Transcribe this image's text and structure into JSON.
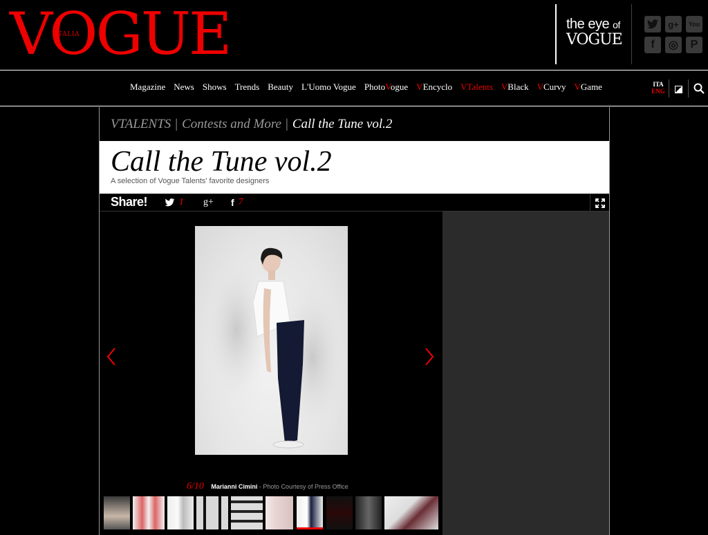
{
  "header": {
    "logo": "VOGUE",
    "logo_sub": "ITALIA",
    "eye_the": "the eye",
    "eye_of": "of",
    "eye_vogue": "VOGUE",
    "social": [
      "twitter-icon",
      "google-plus-icon",
      "youtube-icon",
      "facebook-icon",
      "instagram-icon",
      "pinterest-icon"
    ],
    "social_glyphs": [
      "t",
      "g+",
      "You",
      "f",
      "◎",
      "P"
    ]
  },
  "nav": {
    "items": [
      {
        "label": "Magazine"
      },
      {
        "label": "News"
      },
      {
        "label": "Shows"
      },
      {
        "label": "Trends"
      },
      {
        "label": "Beauty"
      },
      {
        "label": "L'Uomo Vogue"
      },
      {
        "pre": "Photo",
        "v": "V",
        "post": "ogue"
      },
      {
        "v": "V",
        "post": "Encyclo"
      },
      {
        "v": "V",
        "post": "Talents"
      },
      {
        "v": "V",
        "post": "Black"
      },
      {
        "v": "V",
        "post": "Curvy"
      },
      {
        "v": "V",
        "post": "Game"
      }
    ],
    "lang_ita": "ITA",
    "lang_eng": "ENG"
  },
  "breadcrumb": {
    "items": [
      "VTALENTS",
      "Contests and More"
    ],
    "separator": "|",
    "current": "Call the Tune vol.2"
  },
  "article": {
    "title": "Call the Tune vol.2",
    "subtitle": "A selection of Vogue Talents' favorite designers"
  },
  "share": {
    "label": "Share!",
    "twitter_count": "1",
    "gplus_glyph": "g+",
    "facebook_glyph": "f",
    "facebook_count": "7"
  },
  "gallery": {
    "counter": "6/10",
    "designer": "Marianni Cimini",
    "credit": " - Photo Courtesy of Press Office",
    "active_index": 6,
    "thumbnail_count": 10
  },
  "colors": {
    "accent": "#e00000",
    "background": "#000000",
    "panel": "#2b2b2b"
  }
}
